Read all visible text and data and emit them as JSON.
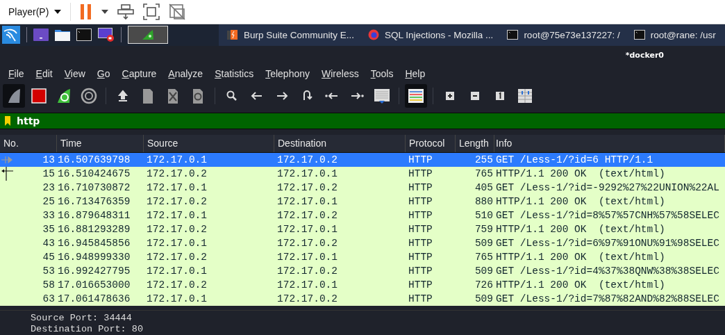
{
  "player_bar": {
    "menu": "Player(P)",
    "paused": true
  },
  "taskbar": {
    "launchers": [
      {
        "kind": "dragon"
      },
      {
        "kind": "desktop"
      },
      {
        "kind": "folder"
      },
      {
        "kind": "terminal"
      },
      {
        "kind": "recorder"
      }
    ],
    "workspace": {
      "selected": true
    },
    "windows": [
      {
        "kind": "burp",
        "title": "Burp Suite Community E..."
      },
      {
        "kind": "firefox",
        "title": "SQL Injections - Mozilla ..."
      },
      {
        "kind": "terminal",
        "title": "root@75e73e137227: /"
      },
      {
        "kind": "terminal",
        "title": "root@rane: /usr"
      }
    ]
  },
  "window": {
    "title": "*docker0"
  },
  "menu": [
    "File",
    "Edit",
    "View",
    "Go",
    "Capture",
    "Analyze",
    "Statistics",
    "Telephony",
    "Wireless",
    "Tools",
    "Help"
  ],
  "toolbar": [
    {
      "kind": "start",
      "on": true
    },
    {
      "kind": "stop",
      "on": false
    },
    {
      "kind": "restart",
      "on": false
    },
    {
      "kind": "options",
      "on": false
    },
    {
      "kind": "sep"
    },
    {
      "kind": "open",
      "on": false
    },
    {
      "kind": "file",
      "on": false
    },
    {
      "kind": "close",
      "on": false
    },
    {
      "kind": "reload",
      "on": false
    },
    {
      "kind": "sep"
    },
    {
      "kind": "search",
      "on": false
    },
    {
      "kind": "back",
      "on": false
    },
    {
      "kind": "forward",
      "on": false
    },
    {
      "kind": "jump",
      "on": false
    },
    {
      "kind": "first",
      "on": false
    },
    {
      "kind": "last",
      "on": false
    },
    {
      "kind": "autoscroll",
      "on": false
    },
    {
      "kind": "sep"
    },
    {
      "kind": "colorize",
      "on": true
    },
    {
      "kind": "sep"
    },
    {
      "kind": "zoomin",
      "on": false
    },
    {
      "kind": "zoomout",
      "on": false
    },
    {
      "kind": "normal",
      "on": false
    },
    {
      "kind": "resize",
      "on": false
    }
  ],
  "filter": {
    "value": "http"
  },
  "table": {
    "columns": [
      "No.",
      "Time",
      "Source",
      "Destination",
      "Protocol",
      "Length",
      "Info"
    ],
    "rows": [
      {
        "selected": true,
        "kind": "request",
        "cells": [
          "13",
          "16.507639798",
          "172.17.0.1",
          "172.17.0.2",
          "HTTP",
          "255",
          "GET /Less-1/?id=6 HTTP/1.1"
        ]
      },
      {
        "selected": false,
        "kind": "response",
        "cells": [
          "15",
          "16.510424675",
          "172.17.0.2",
          "172.17.0.1",
          "HTTP",
          "765",
          "HTTP/1.1 200 OK  (text/html)"
        ]
      },
      {
        "selected": false,
        "kind": "plain",
        "cells": [
          "23",
          "16.710730872",
          "172.17.0.1",
          "172.17.0.2",
          "HTTP",
          "405",
          "GET /Less-1/?id=-9292%27%22UNION%22AL"
        ]
      },
      {
        "selected": false,
        "kind": "plain",
        "cells": [
          "25",
          "16.713476359",
          "172.17.0.2",
          "172.17.0.1",
          "HTTP",
          "880",
          "HTTP/1.1 200 OK  (text/html)"
        ]
      },
      {
        "selected": false,
        "kind": "plain",
        "cells": [
          "33",
          "16.879648311",
          "172.17.0.1",
          "172.17.0.2",
          "HTTP",
          "510",
          "GET /Less-1/?id=8%57%57CNH%57%58SELEC"
        ]
      },
      {
        "selected": false,
        "kind": "plain",
        "cells": [
          "35",
          "16.881293289",
          "172.17.0.2",
          "172.17.0.1",
          "HTTP",
          "759",
          "HTTP/1.1 200 OK  (text/html)"
        ]
      },
      {
        "selected": false,
        "kind": "plain",
        "cells": [
          "43",
          "16.945845856",
          "172.17.0.1",
          "172.17.0.2",
          "HTTP",
          "509",
          "GET /Less-1/?id=6%97%91ONU%91%98SELEC"
        ]
      },
      {
        "selected": false,
        "kind": "plain",
        "cells": [
          "45",
          "16.948999330",
          "172.17.0.2",
          "172.17.0.1",
          "HTTP",
          "765",
          "HTTP/1.1 200 OK  (text/html)"
        ]
      },
      {
        "selected": false,
        "kind": "plain",
        "cells": [
          "53",
          "16.992427795",
          "172.17.0.1",
          "172.17.0.2",
          "HTTP",
          "509",
          "GET /Less-1/?id=4%37%38QNW%38%38SELEC"
        ]
      },
      {
        "selected": false,
        "kind": "plain",
        "cells": [
          "58",
          "17.016653000",
          "172.17.0.2",
          "172.17.0.1",
          "HTTP",
          "726",
          "HTTP/1.1 200 OK  (text/html)"
        ]
      },
      {
        "selected": false,
        "kind": "plain",
        "cells": [
          "63",
          "17.061478636",
          "172.17.0.1",
          "172.17.0.2",
          "HTTP",
          "509",
          "GET /Less-1/?id=7%87%82AND%82%88SELEC"
        ]
      }
    ]
  },
  "details": [
    "Source Port: 34444",
    "Destination Port: 80"
  ]
}
